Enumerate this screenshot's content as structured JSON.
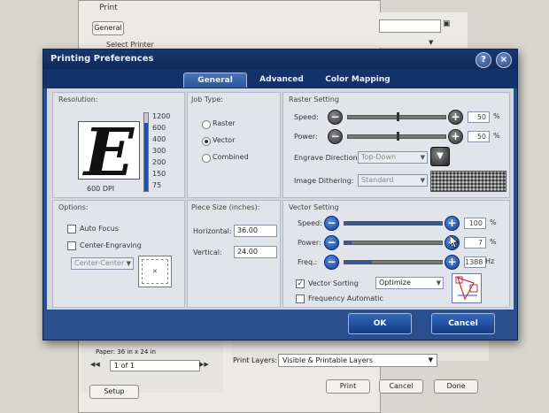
{
  "background_window": {
    "title": "Print",
    "tab": "General",
    "select_printer": "Select Printer",
    "paper": "Paper: 36 in x 24 in",
    "page_of": "1 of 1",
    "print_layers_label": "Print Layers:",
    "print_layers_value": "Visible & Printable Layers",
    "setup_label": "Setup",
    "print_label": "Print",
    "cancel_label": "Cancel",
    "done_label": "Done"
  },
  "dialog": {
    "title": "Printing Preferences",
    "help_label": "?",
    "close_label": "×",
    "tabs": [
      {
        "label": "General",
        "active": true
      },
      {
        "label": "Advanced",
        "active": false
      },
      {
        "label": "Color Mapping",
        "active": false
      }
    ],
    "resolution": {
      "title": "Resolution:",
      "preview_letter": "E",
      "current": "600 DPI",
      "levels": [
        "1200",
        "600",
        "400",
        "300",
        "200",
        "150",
        "75"
      ],
      "fill_fraction": 0.88
    },
    "job_type": {
      "title": "Job Type:",
      "options": [
        {
          "label": "Raster",
          "selected": false
        },
        {
          "label": "Vector",
          "selected": true
        },
        {
          "label": "Combined",
          "selected": false
        }
      ]
    },
    "raster": {
      "title": "Raster Setting",
      "speed_label": "Speed:",
      "speed_value": "50",
      "speed_fraction": 0.5,
      "power_label": "Power:",
      "power_value": "50",
      "power_fraction": 0.5,
      "unit": "%",
      "engrave_direction_label": "Engrave Direction:",
      "engrave_direction_value": "Top-Down",
      "dithering_label": "Image Dithering:",
      "dithering_value": "Standard"
    },
    "options": {
      "title": "Options:",
      "auto_focus_label": "Auto Focus",
      "auto_focus_checked": false,
      "center_engraving_label": "Center-Engraving",
      "center_engraving_checked": false,
      "center_position_value": "Center-Center"
    },
    "piece_size": {
      "title": "Piece Size (inches):",
      "horizontal_label": "Horizontal:",
      "horizontal_value": "36.00",
      "vertical_label": "Vertical:",
      "vertical_value": "24.00"
    },
    "vector": {
      "title": "Vector Setting",
      "speed_label": "Speed:",
      "speed_value": "100",
      "speed_fraction": 1.0,
      "power_label": "Power:",
      "power_value": "7",
      "power_fraction": 0.07,
      "freq_label": "Freq.:",
      "freq_value": "1388",
      "freq_fraction": 0.28,
      "percent_unit": "%",
      "hz_unit": "Hz",
      "vector_sorting_label": "Vector Sorting",
      "vector_sorting_checked": true,
      "sorting_mode_value": "Optimize",
      "frequency_automatic_label": "Frequency Automatic",
      "frequency_automatic_checked": false
    },
    "ok_label": "OK",
    "cancel_label": "Cancel"
  },
  "colors": {
    "dialog_blue": "#2a4f8e",
    "title_dark": "#10295a",
    "slider_blue": "#2358c7"
  }
}
